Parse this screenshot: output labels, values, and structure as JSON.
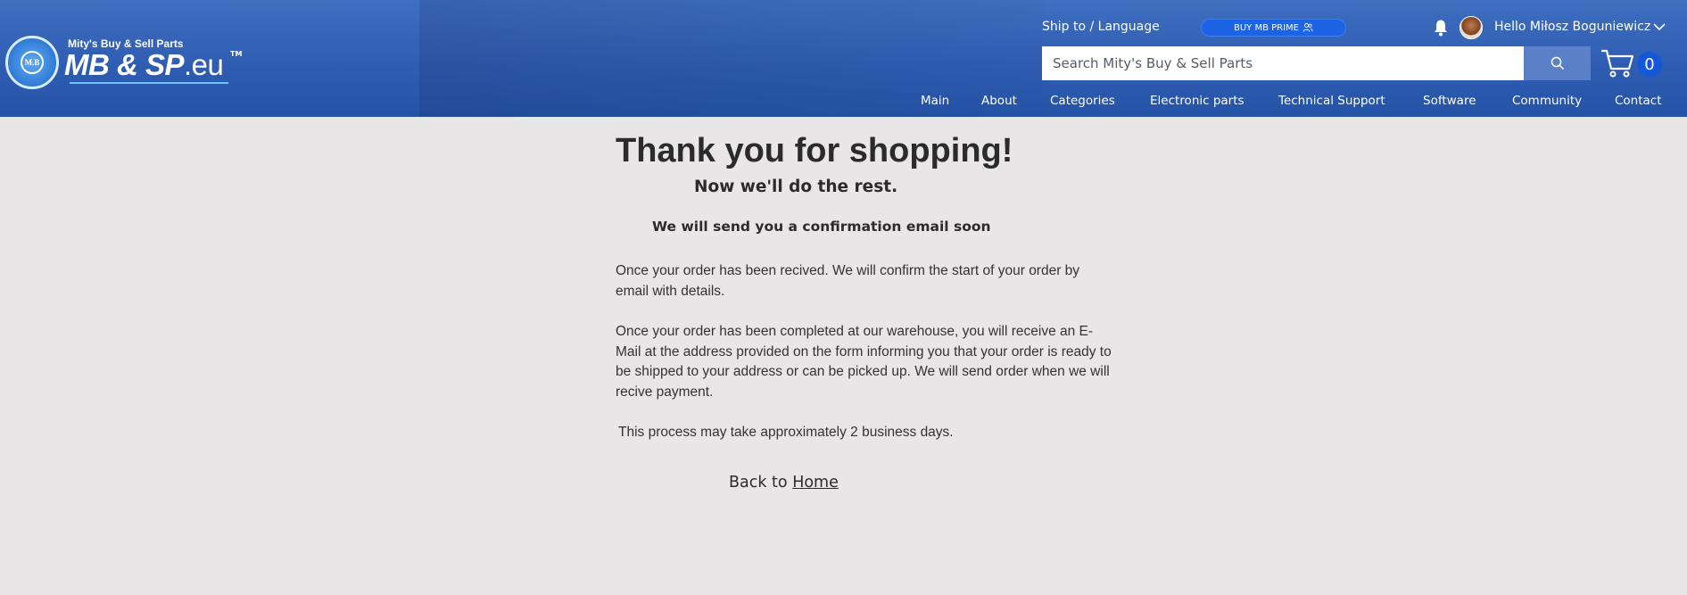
{
  "header": {
    "logo": {
      "badge_text": "M.B",
      "small_text": "Mity's Buy & Sell Parts",
      "main_text": "MB & SP",
      "main_suffix": ".eu",
      "trademark": "TM"
    },
    "ship_language_label": "Ship to / Language",
    "prime_button_label": "BUY MB PRIME",
    "greeting": "Hello Miłosz Boguniewicz",
    "search": {
      "placeholder": "Search Mity's Buy & Sell Parts"
    },
    "cart_count": "0",
    "nav": [
      "Main",
      "About",
      "Categories",
      "Electronic parts",
      "Technical Support",
      "Software",
      "Community",
      "Contact"
    ]
  },
  "main": {
    "title": "Thank you for shopping!",
    "subtitle": "Now we'll do the rest.",
    "confirmation": "We will send you a confirmation email soon",
    "paragraph1": "Once your order has been recived. We will confirm the start of your order by email with details.",
    "paragraph2": "Once your order has been completed at our warehouse, you will receive an E-Mail at the address provided on the form informing you that your order is ready to be shipped to your address or can be picked up. We will send order when we will recive payment.",
    "paragraph3": "This process may take approximately 2 business days.",
    "back_prefix": "Back to ",
    "back_link": "Home"
  },
  "colors": {
    "header_top": "#3f6fc0",
    "header_bottom": "#2453a6",
    "page_background": "#e8e6e6",
    "prime_button": "#1d63e6",
    "search_button": "#5a80c7",
    "cart_badge": "#1656d8"
  }
}
